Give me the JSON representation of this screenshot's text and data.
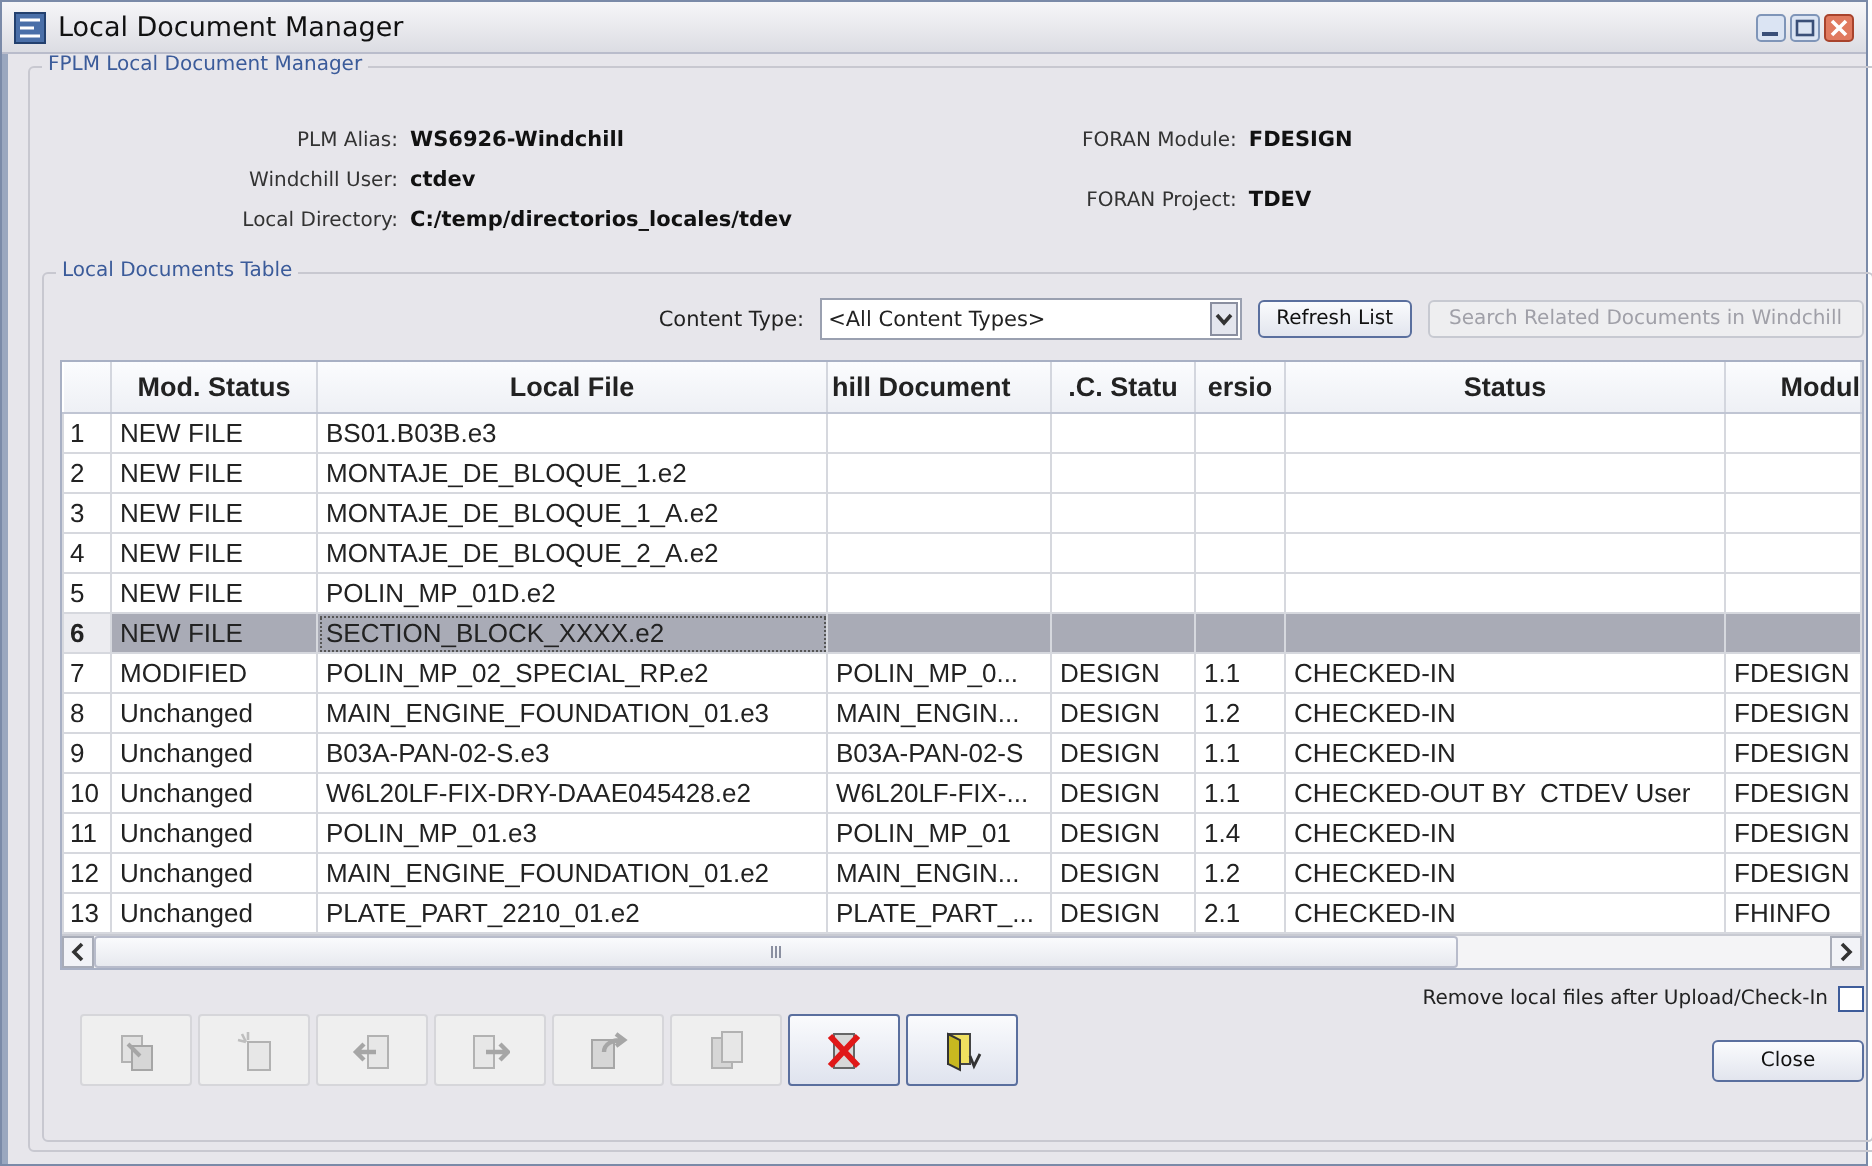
{
  "window": {
    "title": "Local Document Manager"
  },
  "group": {
    "title": "FPLM Local Document Manager"
  },
  "info_left": [
    {
      "label": "PLM Alias:",
      "value": "WS6926-Windchill"
    },
    {
      "label": "Windchill User:",
      "value": "ctdev"
    },
    {
      "label": "Local Directory:",
      "value": "C:/temp/directorios_locales/tdev"
    }
  ],
  "info_right": [
    {
      "label": "FORAN Module:",
      "value": "FDESIGN"
    },
    {
      "label": "FORAN Project:",
      "value": "TDEV"
    }
  ],
  "table_group": {
    "title": "Local Documents Table"
  },
  "content_type": {
    "label": "Content Type:",
    "value": "<All Content Types>"
  },
  "top_buttons": [
    {
      "label": "Refresh List",
      "disabled": false
    },
    {
      "label": "Search Related Documents in Windchill",
      "disabled": true
    }
  ],
  "table": {
    "columns": [
      "Mod. Status",
      "Local File",
      "hill Document",
      ".C. Statu",
      "ersio",
      "Status",
      "Modul"
    ],
    "rows": [
      {
        "number": "1",
        "cells": [
          "NEW FILE",
          "BS01.B03B.e3",
          "",
          "",
          "",
          "",
          ""
        ],
        "selected": false
      },
      {
        "number": "2",
        "cells": [
          "NEW FILE",
          "MONTAJE_DE_BLOQUE_1.e2",
          "",
          "",
          "",
          "",
          ""
        ],
        "selected": false
      },
      {
        "number": "3",
        "cells": [
          "NEW FILE",
          "MONTAJE_DE_BLOQUE_1_A.e2",
          "",
          "",
          "",
          "",
          ""
        ],
        "selected": false
      },
      {
        "number": "4",
        "cells": [
          "NEW FILE",
          "MONTAJE_DE_BLOQUE_2_A.e2",
          "",
          "",
          "",
          "",
          ""
        ],
        "selected": false
      },
      {
        "number": "5",
        "cells": [
          "NEW FILE",
          "POLIN_MP_01D.e2",
          "",
          "",
          "",
          "",
          ""
        ],
        "selected": false
      },
      {
        "number": "6",
        "cells": [
          "NEW FILE",
          "SECTION_BLOCK_XXXX.e2",
          "",
          "",
          "",
          "",
          ""
        ],
        "selected": true
      },
      {
        "number": "7",
        "cells": [
          "MODIFIED",
          "POLIN_MP_02_SPECIAL_RP.e2",
          "POLIN_MP_0...",
          "DESIGN",
          "1.1",
          "CHECKED-IN",
          "FDESIGN"
        ],
        "selected": false
      },
      {
        "number": "8",
        "cells": [
          "Unchanged",
          "MAIN_ENGINE_FOUNDATION_01.e3",
          "MAIN_ENGIN...",
          "DESIGN",
          "1.2",
          "CHECKED-IN",
          "FDESIGN"
        ],
        "selected": false
      },
      {
        "number": "9",
        "cells": [
          "Unchanged",
          "B03A-PAN-02-S.e3",
          "B03A-PAN-02-S",
          "DESIGN",
          "1.1",
          "CHECKED-IN",
          "FDESIGN"
        ],
        "selected": false
      },
      {
        "number": "10",
        "cells": [
          "Unchanged",
          "W6L20LF-FIX-DRY-DAAE045428.e2",
          "W6L20LF-FIX-...",
          "DESIGN",
          "1.1",
          "CHECKED-OUT BY  CTDEV User",
          "FDESIGN"
        ],
        "selected": false
      },
      {
        "number": "11",
        "cells": [
          "Unchanged",
          "POLIN_MP_01.e3",
          "POLIN_MP_01",
          "DESIGN",
          "1.4",
          "CHECKED-IN",
          "FDESIGN"
        ],
        "selected": false
      },
      {
        "number": "12",
        "cells": [
          "Unchanged",
          "MAIN_ENGINE_FOUNDATION_01.e2",
          "MAIN_ENGIN...",
          "DESIGN",
          "1.2",
          "CHECKED-IN",
          "FDESIGN"
        ],
        "selected": false
      },
      {
        "number": "13",
        "cells": [
          "Unchanged",
          "PLATE_PART_2210_01.e2",
          "PLATE_PART_...",
          "DESIGN",
          "2.1",
          "CHECKED-IN",
          "FHINFO"
        ],
        "selected": false
      }
    ]
  },
  "toolbar": [
    {
      "kind": "copy",
      "disabled": true
    },
    {
      "kind": "new",
      "disabled": true
    },
    {
      "kind": "import",
      "disabled": true
    },
    {
      "kind": "export",
      "disabled": true
    },
    {
      "kind": "checkin",
      "disabled": true
    },
    {
      "kind": "duplicate",
      "disabled": true
    },
    {
      "kind": "delete",
      "disabled": false
    },
    {
      "kind": "open",
      "disabled": false
    }
  ],
  "remove_option": {
    "label": "Remove local files after Upload/Check-In",
    "checked": false
  },
  "close_button": {
    "label": "Close"
  }
}
